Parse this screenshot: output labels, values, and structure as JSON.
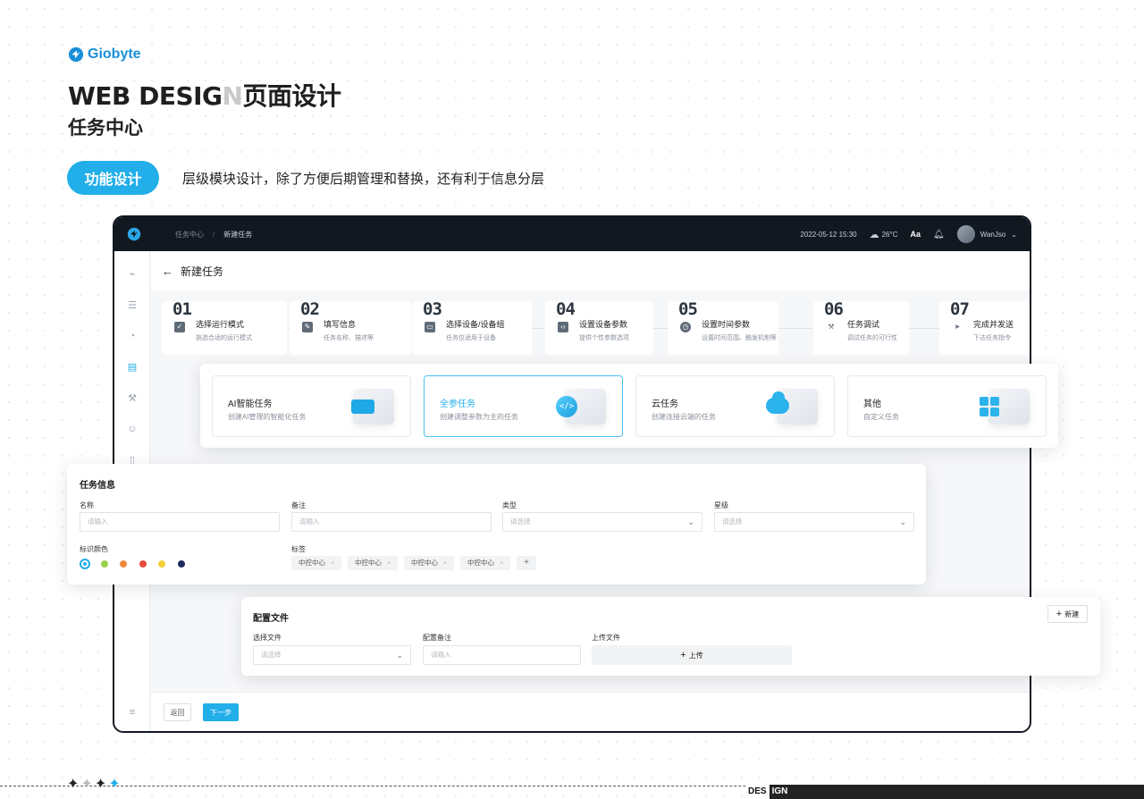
{
  "brand": {
    "name": "Giobyte"
  },
  "header": {
    "title_main": "WEB DESIG",
    "title_ghost": "N",
    "title_cn": "页面设计",
    "subtitle": "任务中心",
    "pill": "功能设计",
    "description": "层级模块设计，除了方便后期管理和替换，还有利于信息分层"
  },
  "topbar": {
    "breadcrumb_root": "任务中心",
    "breadcrumb_sep": "/",
    "breadcrumb_current": "新建任务",
    "datetime": "2022-05-12  15:30",
    "weather_temp": "26°C",
    "font_label": "Aa",
    "username": "WanJso"
  },
  "page": {
    "title": "新建任务",
    "back_arrow": "←"
  },
  "steps": [
    {
      "num": "01",
      "title": "选择运行模式",
      "desc": "挑选合适的运行模式"
    },
    {
      "num": "02",
      "title": "填写信息",
      "desc": "任务名称、描述等"
    },
    {
      "num": "03",
      "title": "选择设备/设备组",
      "desc": "任务仅适用于设备"
    },
    {
      "num": "04",
      "title": "设置设备参数",
      "desc": "提供个性参数选项"
    },
    {
      "num": "05",
      "title": "设置时间参数",
      "desc": "设置时间范围、触发机制等"
    },
    {
      "num": "06",
      "title": "任务调试",
      "desc": "调试任务的可行性"
    },
    {
      "num": "07",
      "title": "完成并发送",
      "desc": "下达任务指令"
    }
  ],
  "task_types": [
    {
      "title": "AI智能任务",
      "desc": "创建AI管理的智能化任务"
    },
    {
      "title": "全参任务",
      "desc": "创建调整参数为主的任务"
    },
    {
      "title": "云任务",
      "desc": "创建连接云端的任务"
    },
    {
      "title": "其他",
      "desc": "自定义任务"
    }
  ],
  "task_info": {
    "title": "任务信息",
    "name_label": "名称",
    "name_placeholder": "请输入",
    "remark_label": "备注",
    "remark_placeholder": "请输入",
    "type_label": "类型",
    "type_placeholder": "请选择",
    "level_label": "星级",
    "level_placeholder": "请选择",
    "color_label": "标识颜色",
    "tags_label": "标签",
    "tags": [
      "中控中心",
      "中控中心",
      "中控中心",
      "中控中心"
    ],
    "tag_close": "×",
    "add_tag": "+",
    "colors": [
      "#21aee9",
      "#9ad14b",
      "#f08a3c",
      "#e94b3c",
      "#f6cf3a",
      "#1f2a5c"
    ]
  },
  "config": {
    "title": "配置文件",
    "new_button": "新建",
    "file_label": "选择文件",
    "file_placeholder": "请选择",
    "remark_label": "配置备注",
    "remark_placeholder": "请输入",
    "upload_label": "上传文件",
    "upload_button": "上传"
  },
  "footer": {
    "back": "返回",
    "next": "下一步"
  },
  "bottom": {
    "word_a": "DES",
    "word_b": "IGN"
  },
  "accent_color": "#21aee9"
}
